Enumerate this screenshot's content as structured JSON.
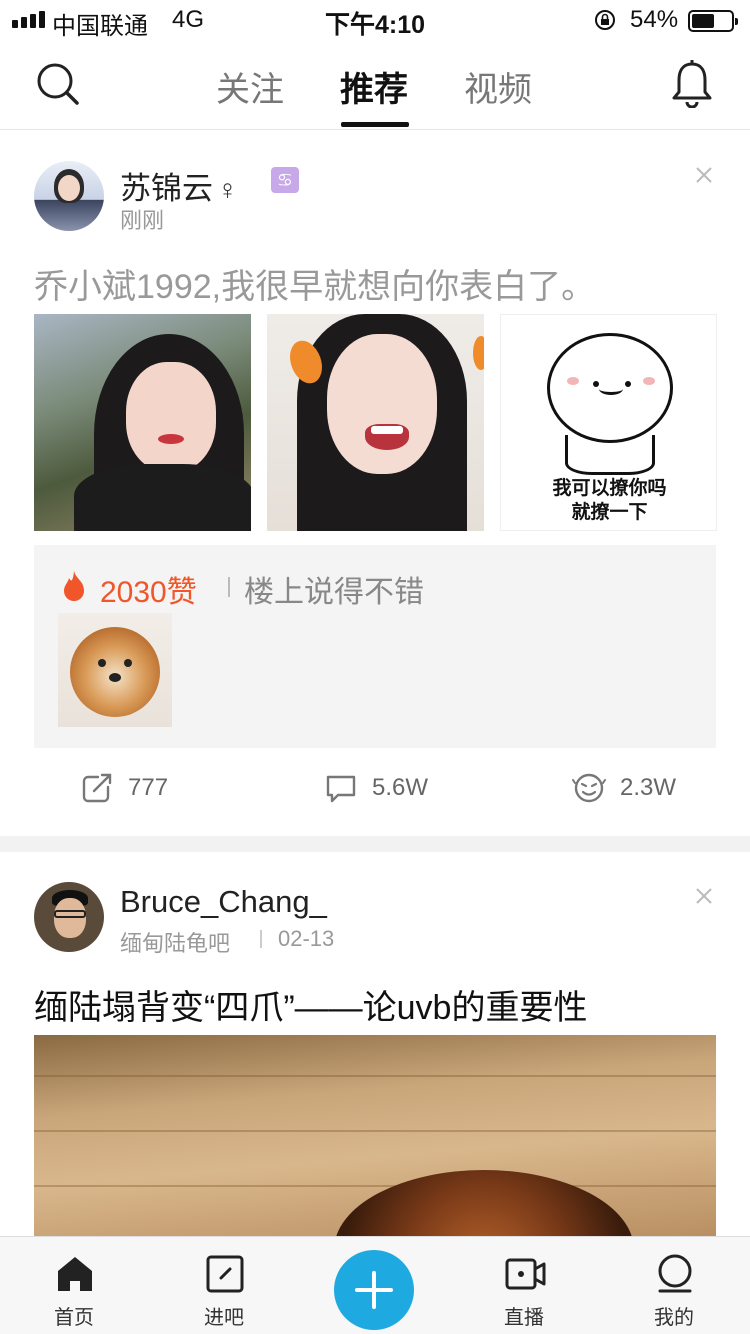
{
  "status_bar": {
    "carrier": "中国联通",
    "network": "4G",
    "time": "下午4:10",
    "battery": "54%"
  },
  "top_nav": {
    "tabs": [
      {
        "label": "关注"
      },
      {
        "label": "推荐",
        "active": true
      },
      {
        "label": "视频"
      }
    ]
  },
  "posts": [
    {
      "username": "苏锦云",
      "gender_symbol": "♀",
      "zodiac_icon": "cancer-icon",
      "time": "刚刚",
      "text": "乔小斌1992,我很早就想向你表白了。",
      "images": [
        "girl-photo",
        "girl-smile-photo",
        "meme-sticker"
      ],
      "meme_caption_1": "我可以撩你吗",
      "meme_caption_2": "就撩一下",
      "hot_comment": {
        "likes": "2030赞",
        "text": "楼上说得不错"
      },
      "actions": {
        "share": "777",
        "comment": "5.6W",
        "like": "2.3W"
      }
    },
    {
      "username": "Bruce_Chang_",
      "forum": "缅甸陆龟吧",
      "date": "02-13",
      "title": "缅陆塌背变“四爪”——论uvb的重要性"
    }
  ],
  "tab_bar": {
    "items": [
      {
        "label": "首页"
      },
      {
        "label": "进吧"
      },
      {
        "label": "直播"
      },
      {
        "label": "我的"
      }
    ]
  },
  "colors": {
    "accent": "#1fa9e1",
    "hot": "#f0562a"
  }
}
